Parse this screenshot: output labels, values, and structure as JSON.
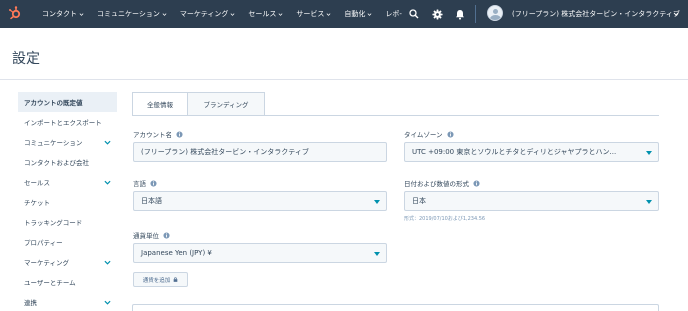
{
  "topnav": {
    "items": [
      {
        "label": "コンタクト"
      },
      {
        "label": "コミュニケーション"
      },
      {
        "label": "マーケティング"
      },
      {
        "label": "セールス"
      },
      {
        "label": "サービス"
      },
      {
        "label": "自動化"
      },
      {
        "label": "レポ-"
      }
    ],
    "account_name": "(フリープラン) 株式会社タービン・インタラクティブ",
    "background": "#2d3e50",
    "brand_color": "#ff7a59"
  },
  "page": {
    "title": "設定"
  },
  "sidebar": {
    "items": [
      {
        "label": "アカウントの既定値"
      },
      {
        "label": "インポートとエクスポート"
      },
      {
        "label": "コミュニケーション"
      },
      {
        "label": "コンタクトおよび会社"
      },
      {
        "label": "セールス"
      },
      {
        "label": "チケット"
      },
      {
        "label": "トラッキングコード"
      },
      {
        "label": "プロパティー"
      },
      {
        "label": "マーケティング"
      },
      {
        "label": "ユーザーとチーム"
      },
      {
        "label": "連携"
      }
    ]
  },
  "tabs": [
    {
      "label": "全般情報"
    },
    {
      "label": "ブランディング"
    }
  ],
  "form": {
    "account_name_label": "アカウント名",
    "account_name_value": "(フリープラン) 株式会社タービン・インタラクティブ",
    "timezone_label": "タイムゾーン",
    "timezone_value": "UTC +09:00 東京とソウルとチタとディリとジャヤプラとハン...",
    "language_label": "言語",
    "language_value": "日本語",
    "date_format_label": "日付および数値の形式",
    "date_format_value": "日本",
    "date_format_hint": "形式：2019/07/10および1,234.56",
    "currency_label": "通貨単位",
    "currency_value": "Japanese Yen (JPY) ¥",
    "add_currency_button": "通貨を追加"
  },
  "colors": {
    "accent": "#0091ae",
    "text": "#33475b",
    "border": "#cbd6e2"
  }
}
